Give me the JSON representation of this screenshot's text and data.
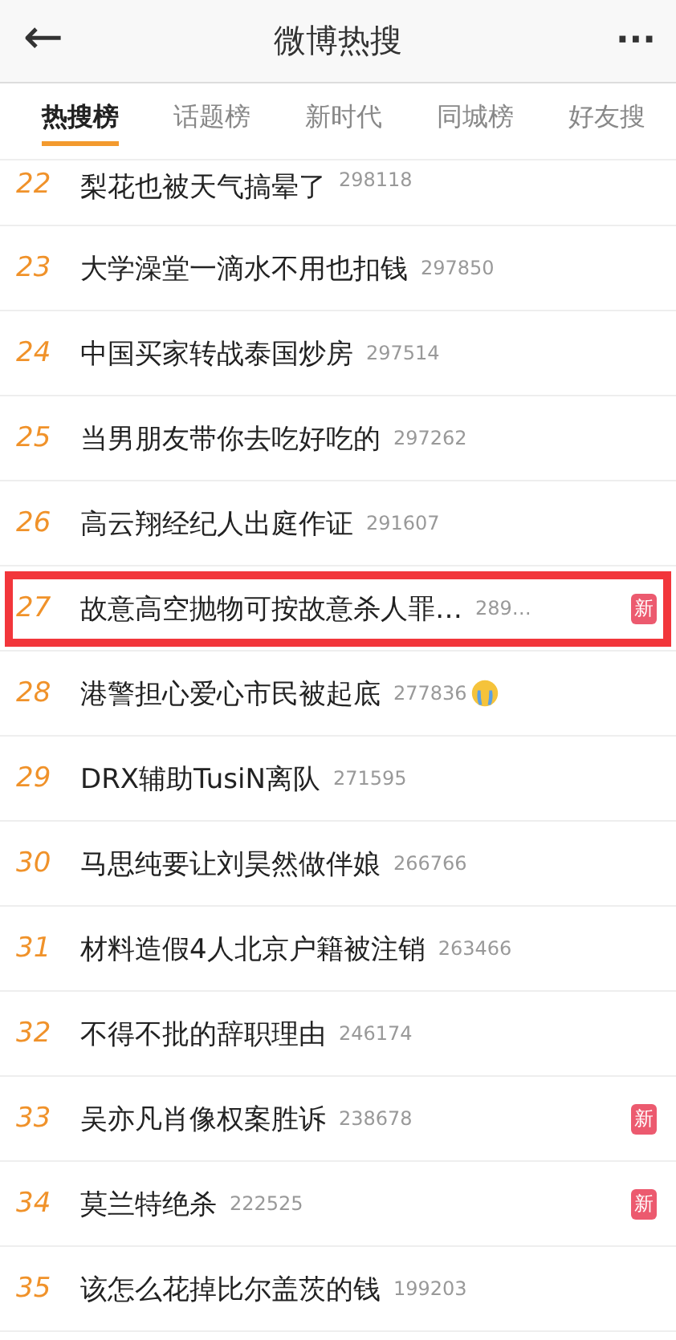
{
  "header": {
    "back": "←",
    "title": "微博热搜",
    "more": "···"
  },
  "tabs": [
    {
      "label": "热搜榜",
      "selected": true
    },
    {
      "label": "话题榜",
      "selected": false
    },
    {
      "label": "新时代",
      "selected": false
    },
    {
      "label": "同城榜",
      "selected": false
    },
    {
      "label": "好友搜",
      "selected": false
    }
  ],
  "items": [
    {
      "rank": "22",
      "title": "梨花也被天气搞晕了",
      "count": "298118",
      "highlighted": false
    },
    {
      "rank": "23",
      "title": "大学澡堂一滴水不用也扣钱",
      "count": "297850",
      "highlighted": false
    },
    {
      "rank": "24",
      "title": "中国买家转战泰国炒房",
      "count": "297514",
      "highlighted": false
    },
    {
      "rank": "25",
      "title": "当男朋友带你去吃好吃的",
      "count": "297262",
      "highlighted": false
    },
    {
      "rank": "26",
      "title": "高云翔经纪人出庭作证",
      "count": "291607",
      "highlighted": false
    },
    {
      "rank": "27",
      "title": "故意高空抛物可按故意杀人罪…",
      "count": "289…",
      "badge": "新",
      "highlighted": true
    },
    {
      "rank": "28",
      "title": "港警担心爱心市民被起底",
      "count": "277836",
      "emoji": true,
      "highlighted": false
    },
    {
      "rank": "29",
      "title": "DRX辅助TusiN离队",
      "count": "271595",
      "highlighted": false
    },
    {
      "rank": "30",
      "title": "马思纯要让刘昊然做伴娘",
      "count": "266766",
      "highlighted": false
    },
    {
      "rank": "31",
      "title": "材料造假4人北京户籍被注销",
      "count": "263466",
      "highlighted": false
    },
    {
      "rank": "32",
      "title": "不得不批的辞职理由",
      "count": "246174",
      "highlighted": false
    },
    {
      "rank": "33",
      "title": "吴亦凡肖像权案胜诉",
      "count": "238678",
      "badge": "新",
      "highlighted": false
    },
    {
      "rank": "34",
      "title": "莫兰特绝杀",
      "count": "222525",
      "badge": "新",
      "highlighted": false
    },
    {
      "rank": "35",
      "title": "该怎么花掉比尔盖茨的钱",
      "count": "199203",
      "highlighted": false
    }
  ]
}
